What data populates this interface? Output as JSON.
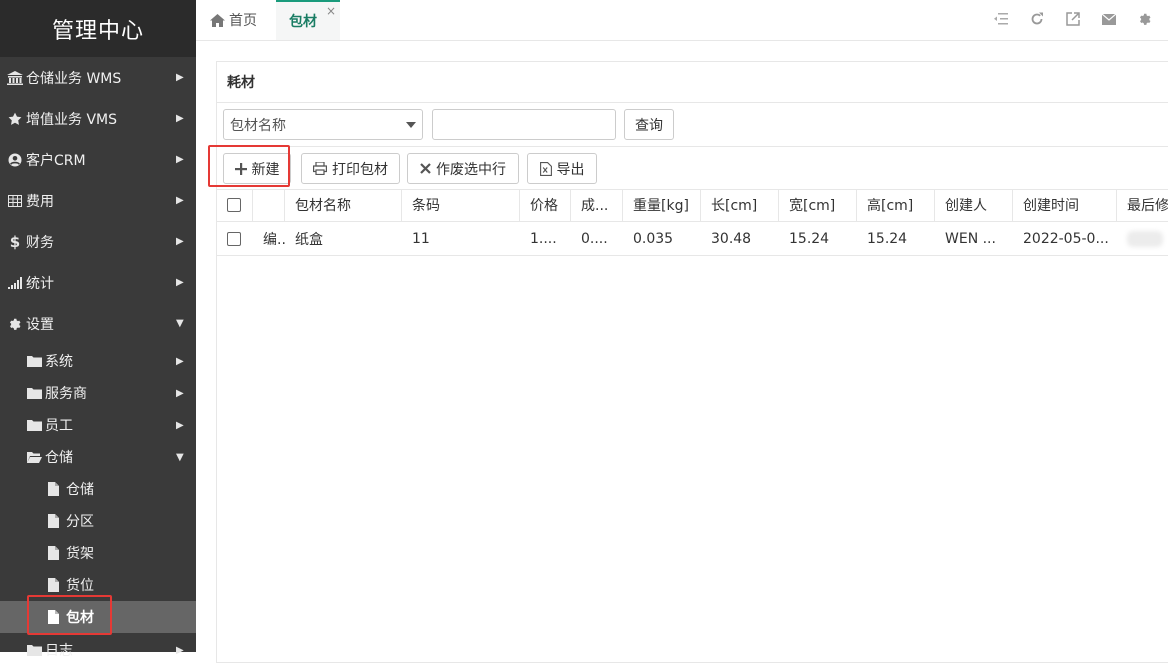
{
  "sidebar": {
    "brand": "管理中心",
    "menu": [
      {
        "label": "仓储业务 WMS",
        "icon": "bank-icon"
      },
      {
        "label": "增值业务 VMS",
        "icon": "star-icon"
      },
      {
        "label": "客户CRM",
        "icon": "user-circle-icon"
      },
      {
        "label": "费用",
        "icon": "table-icon"
      },
      {
        "label": "财务",
        "icon": "dollar-icon"
      },
      {
        "label": "统计",
        "icon": "signal-bars-icon"
      },
      {
        "label": "设置",
        "icon": "gear-icon"
      }
    ],
    "settings_children": [
      {
        "label": "系统",
        "icon": "folder-icon"
      },
      {
        "label": "服务商",
        "icon": "folder-icon"
      },
      {
        "label": "员工",
        "icon": "folder-icon"
      },
      {
        "label": "仓储",
        "icon": "folder-open-icon"
      }
    ],
    "warehouse_children": [
      {
        "label": "仓储",
        "icon": "file-icon"
      },
      {
        "label": "分区",
        "icon": "file-icon"
      },
      {
        "label": "货架",
        "icon": "file-icon"
      },
      {
        "label": "货位",
        "icon": "file-icon"
      },
      {
        "label": "包材",
        "icon": "file-icon",
        "active": true
      }
    ],
    "log_item": {
      "label": "日志",
      "icon": "folder-icon"
    }
  },
  "tabs": {
    "home": "首页",
    "current": "包材",
    "close_glyph": "×"
  },
  "panel": {
    "title": "耗材",
    "search": {
      "field_selected": "包材名称",
      "input_value": "",
      "button": "查询"
    },
    "toolbar": {
      "new": "新建",
      "print": "打印包材",
      "void": "作废选中行",
      "export": "导出"
    },
    "table": {
      "headers": [
        "",
        "",
        "包材名称",
        "条码",
        "价格",
        "成...",
        "重量[kg]",
        "长[cm]",
        "宽[cm]",
        "高[cm]",
        "创建人",
        "创建时间",
        "最后修"
      ],
      "rows": [
        {
          "edit": "编...",
          "name": "纸盒",
          "barcode": "11",
          "price": "1....",
          "cost": "0....",
          "weight": "0.035",
          "length": "30.48",
          "width": "15.24",
          "height": "15.24",
          "creator": "WEN ...",
          "created": "2022-05-0...",
          "last": ""
        }
      ]
    }
  },
  "colors": {
    "sidebar_bg": "#3a3a3a",
    "active_tab": "#1a7d64",
    "highlight_box": "#e53935"
  }
}
